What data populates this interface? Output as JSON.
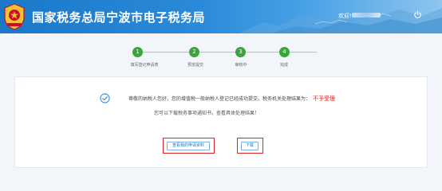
{
  "header": {
    "title": "国家税务总局宁波市电子税务局",
    "welcome": "欢迎!",
    "emblem_icon": "tax-emblem-icon",
    "logout_icon": "power-icon"
  },
  "steps": [
    {
      "number": "1",
      "label": "填写登记申请表"
    },
    {
      "number": "2",
      "label": "预览提交"
    },
    {
      "number": "3",
      "label": "审核中"
    },
    {
      "number": "4",
      "label": "完成"
    }
  ],
  "result": {
    "message": "尊敬的纳税人您好，您的增值税一般纳税人登记已经成功提交，税务机关处理结果为：",
    "status": "不予受理",
    "hint": "您可以下载税务事项通知书，查看具体处理结果！"
  },
  "buttons": {
    "view": "查看我的申请资料",
    "download": "下载"
  },
  "colors": {
    "header_blue": "#1b78c8",
    "step_green": "#3aa63a",
    "status_red": "#e02020",
    "highlight_red": "#e0222a"
  }
}
